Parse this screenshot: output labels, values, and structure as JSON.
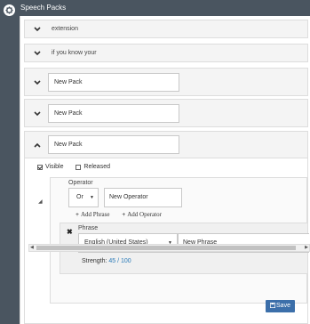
{
  "window": {
    "title": "Speech Packs",
    "app_icon": "gear-icon"
  },
  "packs": [
    {
      "type": "label",
      "text": "extension",
      "chevron": "chevron-down-icon"
    },
    {
      "type": "label",
      "text": "if you know your",
      "chevron": "chevron-down-icon"
    },
    {
      "type": "input",
      "value": "New Pack",
      "chevron": "chevron-down-icon"
    },
    {
      "type": "input",
      "value": "New Pack",
      "chevron": "chevron-down-icon"
    },
    {
      "type": "input",
      "value": "New Pack",
      "chevron": "chevron-up-icon"
    }
  ],
  "expanded_pack": {
    "visible_label": "Visible",
    "visible_checked": true,
    "released_label": "Released",
    "released_checked": false,
    "operator": {
      "title": "Operator",
      "type_value": "Or",
      "name_value": "New Operator",
      "add_phrase_label": "Add Phrase",
      "add_operator_label": "Add Operator"
    },
    "phrase": {
      "title": "Phrase",
      "language_value": "English (United States)",
      "phrase_value": "New Phrase",
      "strength_label": "Strength:",
      "strength_value": "45 / 100"
    }
  },
  "save_label": "Save",
  "colors": {
    "titlebar": "#4a5560",
    "save_button": "#3c6faa",
    "strength_text": "#2a7ab8"
  }
}
